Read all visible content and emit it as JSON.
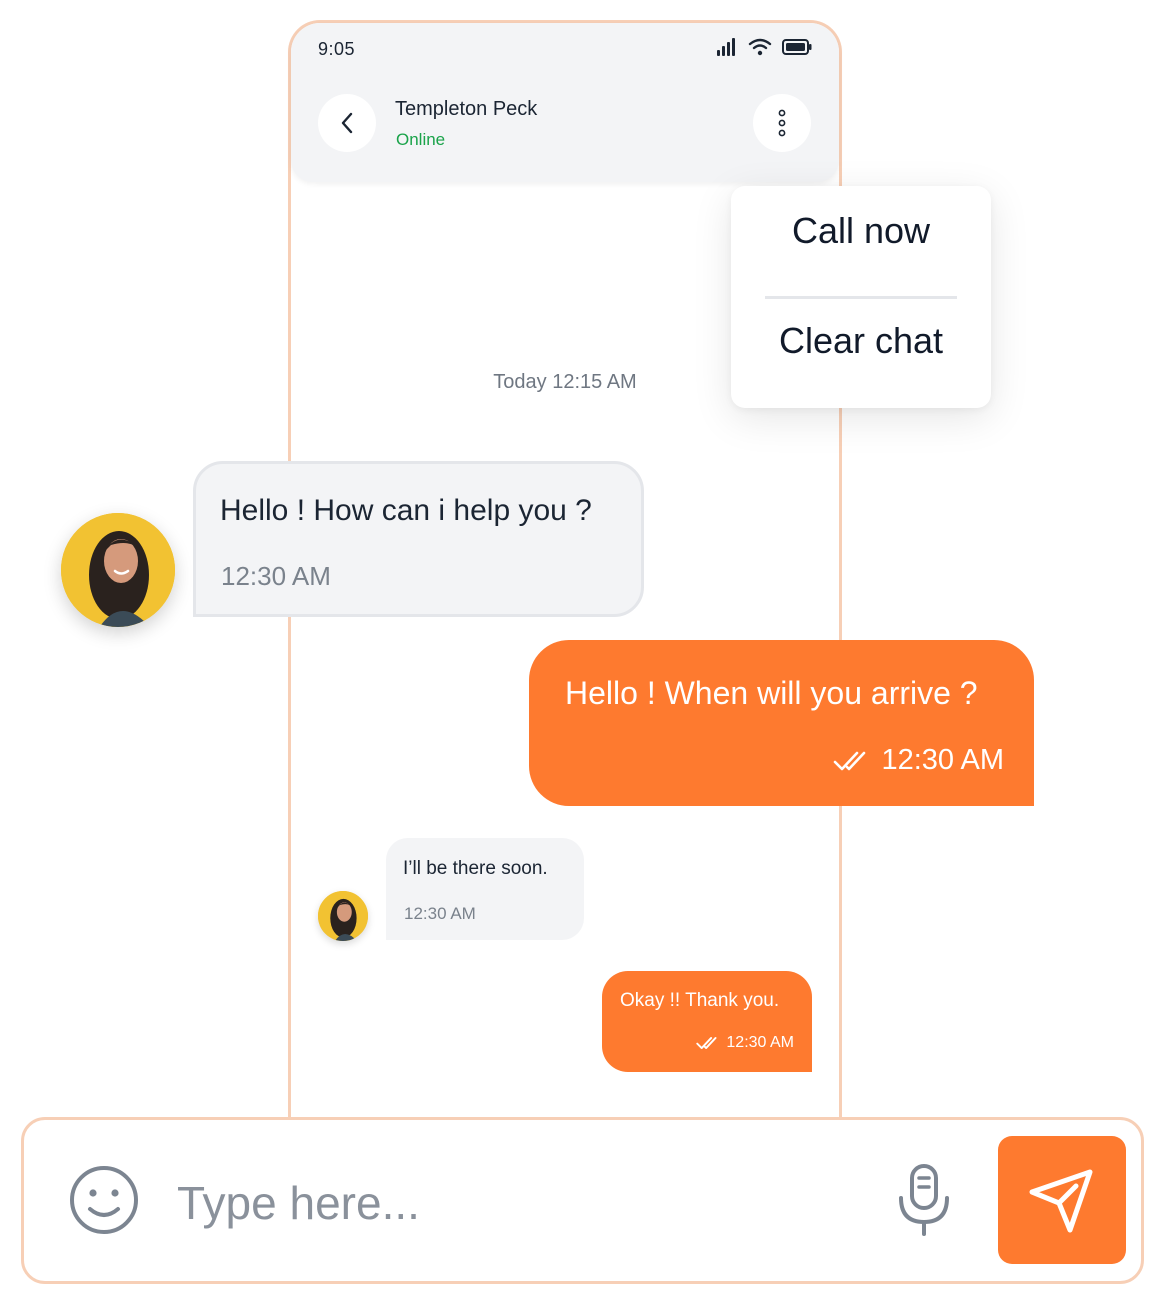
{
  "status_bar": {
    "time": "9:05",
    "icons": [
      "signal-icon",
      "wifi-icon",
      "battery-icon"
    ]
  },
  "header": {
    "contact_name": "Templeton Peck",
    "contact_status": "Online",
    "back_icon": "chevron-left-icon",
    "more_icon": "more-vertical-icon"
  },
  "menu": {
    "items": [
      {
        "label": "Call now"
      },
      {
        "label": "Clear chat"
      }
    ]
  },
  "date_separator": "Today 12:15 AM",
  "messages": [
    {
      "direction": "incoming",
      "text": "Hello ! How can i help you ?",
      "time": "12:30 AM"
    },
    {
      "direction": "outgoing",
      "text": "Hello ! When will you arrive ?",
      "time": "12:30 AM",
      "read": true
    },
    {
      "direction": "incoming",
      "text": "I’ll be there soon.",
      "time": "12:30 AM"
    },
    {
      "direction": "outgoing",
      "text": "Okay !! Thank you.",
      "time": "12:30 AM",
      "read": true
    }
  ],
  "composer": {
    "placeholder": "Type here...",
    "emoji_icon": "smiley-icon",
    "mic_icon": "microphone-icon",
    "send_icon": "send-icon"
  },
  "colors": {
    "accent": "#fe7a2f",
    "online": "#1aa34a",
    "frame_border": "#f7cfb6",
    "incoming_bubble": "#f3f4f6"
  }
}
